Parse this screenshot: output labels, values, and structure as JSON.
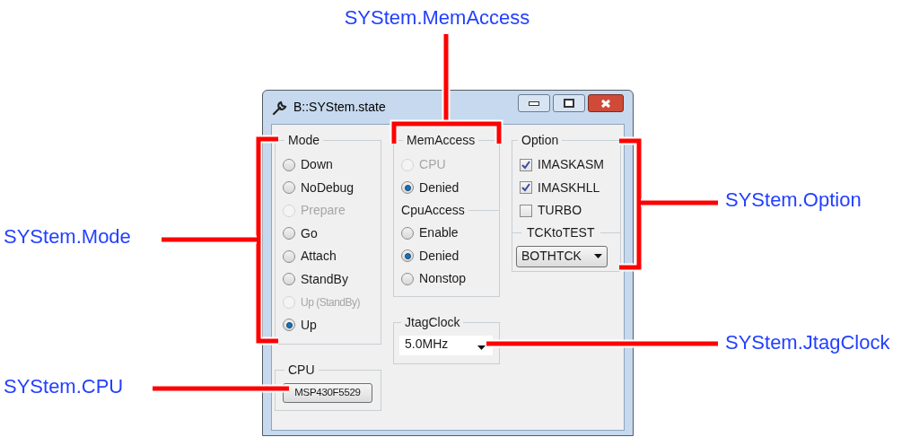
{
  "window": {
    "title": "B::SYStem.state"
  },
  "mode": {
    "label": "Mode",
    "options": [
      {
        "label": "Down",
        "selected": false,
        "disabled": false
      },
      {
        "label": "NoDebug",
        "selected": false,
        "disabled": false
      },
      {
        "label": "Prepare",
        "selected": false,
        "disabled": true
      },
      {
        "label": "Go",
        "selected": false,
        "disabled": false
      },
      {
        "label": "Attach",
        "selected": false,
        "disabled": false
      },
      {
        "label": "StandBy",
        "selected": false,
        "disabled": false
      },
      {
        "label": "Up (StandBy)",
        "selected": false,
        "disabled": true
      },
      {
        "label": "Up",
        "selected": true,
        "disabled": false
      }
    ]
  },
  "cpu": {
    "label": "CPU",
    "value": "MSP430F5529"
  },
  "mem_access": {
    "label": "MemAccess",
    "options": [
      {
        "label": "CPU",
        "selected": false,
        "disabled": true
      },
      {
        "label": "Denied",
        "selected": true,
        "disabled": false
      }
    ]
  },
  "cpu_access": {
    "label": "CpuAccess",
    "options": [
      {
        "label": "Enable",
        "selected": false,
        "disabled": false
      },
      {
        "label": "Denied",
        "selected": true,
        "disabled": false
      },
      {
        "label": "Nonstop",
        "selected": false,
        "disabled": false
      }
    ]
  },
  "jtag_clock": {
    "label": "JtagClock",
    "value": "5.0MHz"
  },
  "option": {
    "label": "Option",
    "checks": [
      {
        "label": "IMASKASM",
        "checked": true
      },
      {
        "label": "IMASKHLL",
        "checked": true
      },
      {
        "label": "TURBO",
        "checked": false
      }
    ],
    "tck_to_test": {
      "label": "TCKtoTEST",
      "value": "BOTHTCK"
    }
  },
  "callouts": [
    {
      "text": "SYStem.MemAccess"
    },
    {
      "text": "SYStem.Mode"
    },
    {
      "text": "SYStem.Option"
    },
    {
      "text": "SYStem.JtagClock"
    },
    {
      "text": "SYStem.CPU"
    }
  ]
}
